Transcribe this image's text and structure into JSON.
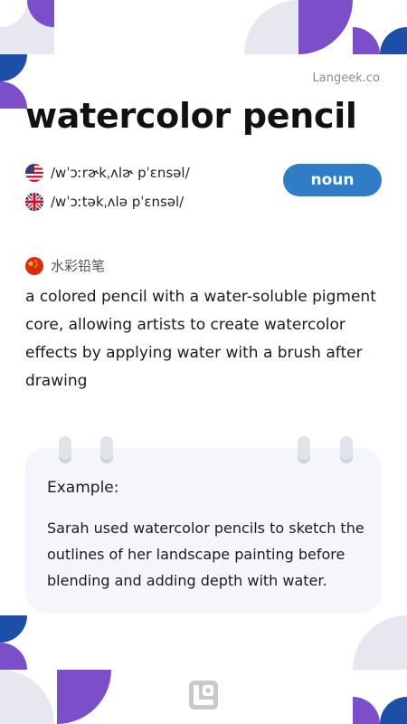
{
  "site": {
    "label": "Langeek.co"
  },
  "entry": {
    "word": "watercolor pencil",
    "part_of_speech": "noun",
    "pronunciations": [
      {
        "region": "us",
        "ipa": "/wˈɔːrɚkˌʌlɚ pˈɛnsəl/"
      },
      {
        "region": "uk",
        "ipa": "/wˈɔːtəkˌʌlə pˈɛnsəl/"
      }
    ],
    "translation": "水彩铅笔",
    "definition": "a colored pencil with a water-soluble pigment core, allowing artists to create watercolor effects by applying water with a brush after drawing"
  },
  "example": {
    "title": "Example:",
    "text": "Sarah used watercolor pencils to sketch the outlines of her landscape painting before blending and adding depth with water."
  },
  "colors": {
    "purple": "#7b4fc9",
    "blue": "#1e4fa8",
    "light_gray": "#e7e8ef",
    "badge_blue": "#2f7dc6"
  },
  "icons": {
    "us_flag": "us-flag-icon",
    "uk_flag": "uk-flag-icon",
    "cn_flag": "china-flag-icon",
    "logo": "langeek-logo-icon"
  }
}
